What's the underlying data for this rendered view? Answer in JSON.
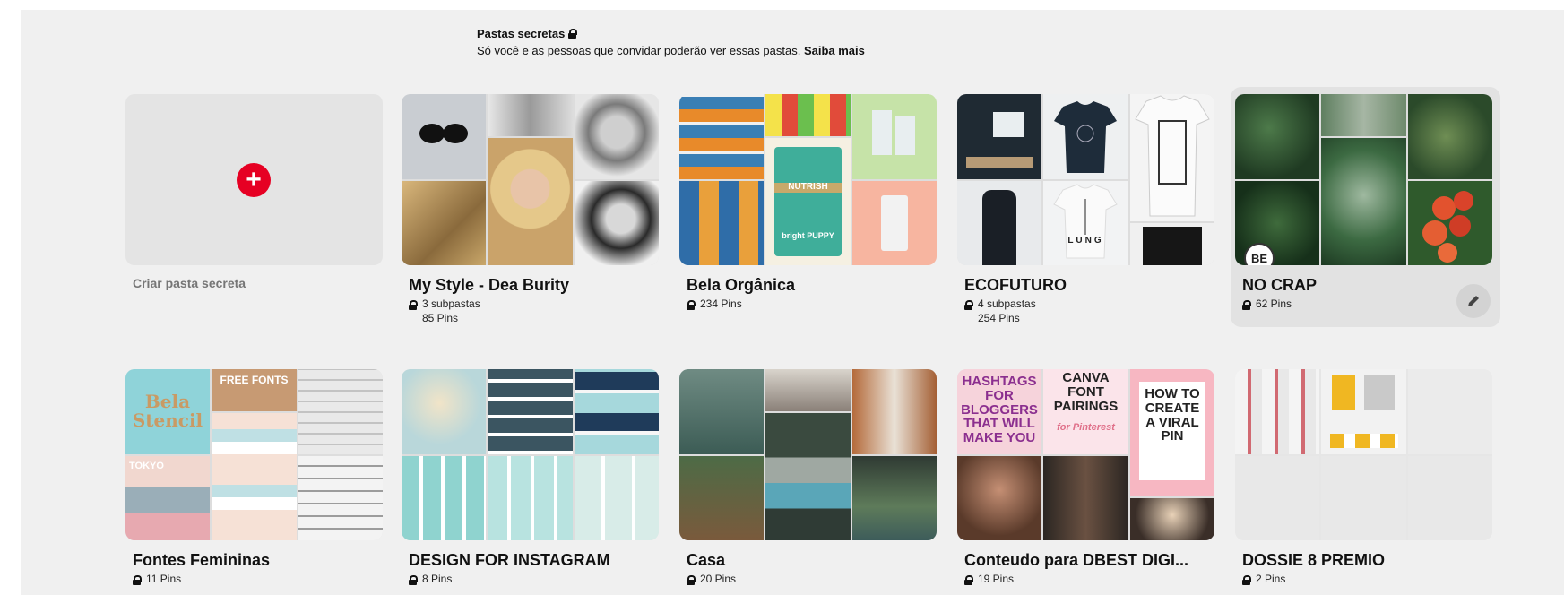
{
  "header": {
    "title": "Pastas secretas",
    "subtitle": "Só você e as pessoas que convidar poderão ver essas pastas.",
    "learn_more": "Saiba mais"
  },
  "create": {
    "label": "Criar pasta secreta",
    "plus": "+"
  },
  "boards": [
    {
      "title": "My Style - Dea Burity",
      "meta1": "3 subpastas",
      "meta2": "85 Pins"
    },
    {
      "title": "Bela Orgânica",
      "meta1": "234 Pins",
      "meta2": ""
    },
    {
      "title": "ECOFUTURO",
      "meta1": "4 subpastas",
      "meta2": "254 Pins"
    },
    {
      "title": "NO CRAP",
      "meta1": "62 Pins",
      "meta2": "",
      "avatar": "BE"
    },
    {
      "title": "Fontes Femininas",
      "meta1": "11 Pins",
      "meta2": ""
    },
    {
      "title": "DESIGN FOR INSTAGRAM",
      "meta1": "8 Pins",
      "meta2": ""
    },
    {
      "title": "Casa",
      "meta1": "20 Pins",
      "meta2": ""
    },
    {
      "title": "Conteudo para DBEST DIGI...",
      "meta1": "19 Pins",
      "meta2": ""
    },
    {
      "title": "DOSSIE 8 PREMIO",
      "meta1": "2 Pins",
      "meta2": ""
    }
  ],
  "pin_text": {
    "bela_stencil": "Bela Stencil",
    "free_fonts": "FREE FONTS",
    "tokyo": "TOKYO",
    "hashtags": "HASHTAGS FOR BLOGGERS THAT WILL MAKE YOU",
    "canva": "CANVA FONT PAIRINGS",
    "for_pinterest": "for Pinterest",
    "viral": "HOW TO CREATE A VIRAL PIN",
    "lung": "LUNG",
    "nutrish": "NUTRISH",
    "bright_puppy": "bright PUPPY"
  },
  "colors": {
    "accent": "#e60023",
    "panel": "#f0f0f0"
  },
  "icons": [
    "lock-icon",
    "plus-icon",
    "pencil-icon"
  ]
}
